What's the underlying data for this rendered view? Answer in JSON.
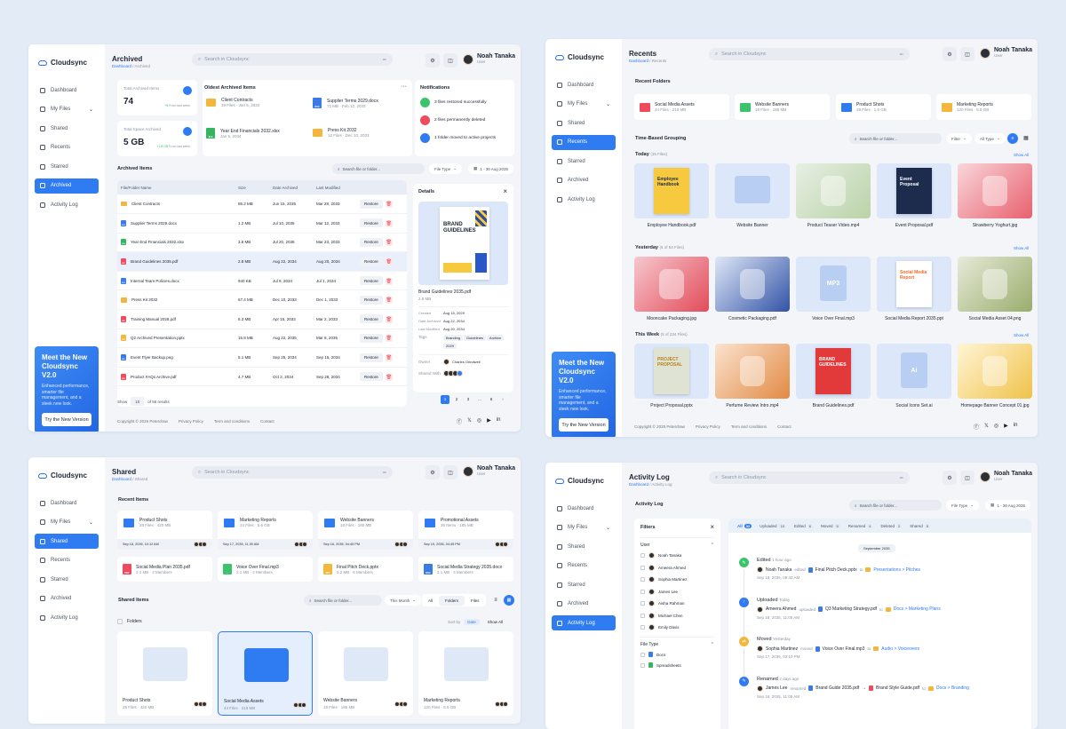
{
  "app": {
    "name": "Cloudsync",
    "user": "Noah Tanaka",
    "role": "User",
    "search_placeholder": "Search in Cloudsync"
  },
  "nav": [
    "Dashboard",
    "My Files",
    "Shared",
    "Recents",
    "Starred",
    "Archived",
    "Activity Log"
  ],
  "promo": {
    "title": "Meet the New Cloudsync V2.0",
    "text": "Enhanced performance, smarter file management, and a sleek new look.",
    "button": "Try the New Version"
  },
  "footer": {
    "copyright": "Copyright © 2025 Peterdraw",
    "links": [
      "Privacy Policy",
      "Term and conditions",
      "Contact"
    ]
  },
  "archived": {
    "title": "Archived",
    "crumb_home": "Dashboard",
    "crumb_current": "Archived",
    "stats": [
      {
        "label": "Total Archived Items",
        "value": "74",
        "trend": "+8",
        "trend_text": "From last week"
      },
      {
        "label": "Total Space Archived",
        "value": "5 GB",
        "trend": "+1.8 GB",
        "trend_text": "From last week"
      }
    ],
    "oldest_title": "Oldest Archived Items",
    "oldest": [
      {
        "name": "Client Contracts",
        "meta": "19 Files · Jan 5, 2034"
      },
      {
        "name": "Supplier Terms 2029.docx",
        "meta": "72 MB · Feb 12, 2033"
      },
      {
        "name": "Year End Financials 2032.xlsx",
        "meta": "Jan 5, 2034"
      },
      {
        "name": "Press Kit 2032",
        "meta": "12 Files · Dec 10, 2033"
      }
    ],
    "notifications_title": "Notifications",
    "notifications": [
      "3 files restored successfully",
      "2 files permanently deleted",
      "1 folder moved to active projects"
    ],
    "items_title": "Archived Items",
    "search_placeholder": "Search file or folder...",
    "file_type": "File Type",
    "date_range": "1 - 30 Aug 2035",
    "columns": [
      "File/Folder Name",
      "Size",
      "Date Archived",
      "Last Modified"
    ],
    "rows": [
      {
        "name": "Client Contracts",
        "size": "85.2 MB",
        "archived": "Jun 15, 2035",
        "modified": "Mar 28, 2033"
      },
      {
        "name": "Supplier Terms 2029.docx",
        "size": "1.2 MB",
        "archived": "Jul 10, 2035",
        "modified": "Mar 12, 2033"
      },
      {
        "name": "Year End Financials 2032.xlsx",
        "size": "3.8 MB",
        "archived": "Jul 20, 2035",
        "modified": "Mar 23, 2033"
      },
      {
        "name": "Brand Guidelines 2035.pdf",
        "size": "2.8 MB",
        "archived": "Aug 22, 2034",
        "modified": "Aug 20, 2034"
      },
      {
        "name": "Internal Team Policies.docx",
        "size": "940 KB",
        "archived": "Jul 9, 2034",
        "modified": "Jul 1, 2034"
      },
      {
        "name": "Press Kit 2032",
        "size": "67.4 MB",
        "archived": "Dec 10, 2033",
        "modified": "Dec 1, 2033"
      },
      {
        "name": "Training Manual 2028.pdf",
        "size": "6.3 MB",
        "archived": "Apr 15, 2033",
        "modified": "Mar 2, 2033"
      },
      {
        "name": "Q2 Archived Presentation.pptx",
        "size": "15.8 MB",
        "archived": "Aug 22, 2035",
        "modified": "Mar 8, 2035"
      },
      {
        "name": "Event Flyer Backup.png",
        "size": "5.1 MB",
        "archived": "Sep 25, 2034",
        "modified": "Sep 15, 2034"
      },
      {
        "name": "Product FAQs Archive.pdf",
        "size": "4.7 MB",
        "archived": "Oct 2, 2034",
        "modified": "Sep 28, 2034"
      }
    ],
    "restore": "Restore",
    "show": "Show",
    "show_n": "10",
    "of_results": "of 56 results",
    "pages": [
      "1",
      "2",
      "3",
      "...",
      "6"
    ],
    "details": {
      "title": "Details",
      "file": "Brand Guidelines 2035.pdf",
      "size": "2.8 MB",
      "cover_text": "Brand Guidelines",
      "fields": [
        [
          "Created",
          "Aug 15, 2029"
        ],
        [
          "Date Archived",
          "Aug 22, 2034"
        ],
        [
          "Last Modified",
          "Aug 20, 2034"
        ]
      ],
      "tags_label": "Tags",
      "tags": [
        "Branding",
        "Guidelines",
        "Archive",
        "2029"
      ],
      "owner_label": "Owner",
      "owner": "Charles Grindwell",
      "shared_label": "Shared With"
    }
  },
  "recents": {
    "title": "Recents",
    "crumb_current": "Recents",
    "folders_title": "Recent Folders",
    "folders": [
      {
        "name": "Social Media Assets",
        "meta": "44 Files · 210 MB"
      },
      {
        "name": "Website Banners",
        "meta": "18 Files · 185 MB"
      },
      {
        "name": "Product Shots",
        "meta": "28 Files · 1.5 GB"
      },
      {
        "name": "Marketing Reports",
        "meta": "120 Files · 5.6 GB"
      }
    ],
    "group_title": "Time-Based Grouping",
    "search_placeholder": "Search file or folder...",
    "filter": "Filter",
    "all_type": "All Type",
    "show_all": "Show All",
    "groups": [
      {
        "title": "Today",
        "count": "(15 Files)",
        "items": [
          "Employee Handbook.pdf",
          "Website Banner",
          "Product Teaser Video.mp4",
          "Event Proposal.pdf",
          "Strawberry Yoghurt.jpg"
        ]
      },
      {
        "title": "Yesterday",
        "count": "(5 of 54 Files)",
        "items": [
          "Mooncake Packaging.jpg",
          "Cosmetic Packaging.pdf",
          "Voice Over Final.mp3",
          "Social Media Report 2035.ppt",
          "Social Media Asset 04.png"
        ]
      },
      {
        "title": "This Week",
        "count": "(5 of 234 Files)",
        "items": [
          "Project Proposal.pptx",
          "Perfume Review Intro.mp4",
          "Brand Guidelines.pdf",
          "Social Icons Set.ai",
          "Homepage Banner Concept 01.jpg"
        ]
      }
    ],
    "thumb_text": {
      "handbook": "Employee Handbook",
      "proposal": "Event Proposal",
      "report": "Social Media Report",
      "project": "PROJECT PROPOSAL",
      "brand": "BRAND GUIDELINES",
      "mp3": "MP3",
      "ai": "Ai"
    }
  },
  "shared": {
    "title": "Shared",
    "crumb_current": "Shared",
    "recent_title": "Recent Items",
    "recent": [
      {
        "name": "Product Shots",
        "meta": "28 Files · 420 MB",
        "date": "Sep 18, 2035, 10:12 AM"
      },
      {
        "name": "Marketing Reports",
        "meta": "24 Files · 5.6 GB",
        "date": "Sep 17, 2035, 11:30 AM"
      },
      {
        "name": "Website Banners",
        "meta": "18 Files · 185 MB",
        "date": "Sep 16, 2035, 04:45 PM"
      },
      {
        "name": "Promotional Assets",
        "meta": "36 Items · 185 MB",
        "date": "Sep 15, 2035, 04:45 PM"
      }
    ],
    "recent_files": [
      {
        "name": "Social Media Plan 2035.pdf",
        "meta": "2.1 MB · 4 Members"
      },
      {
        "name": "Voice Over Final.mp3",
        "meta": "2.1 MB · 4 Members"
      },
      {
        "name": "Final Pitch Deck.pptx",
        "meta": "5.2 MB · 6 Members"
      },
      {
        "name": "Social Media Strategy 2035.docx",
        "meta": "2.1 MB · 4 Members"
      }
    ],
    "items_title": "Shared Items",
    "search_placeholder": "Search file or folder...",
    "period": "This Month",
    "filters": [
      "All",
      "Folders",
      "Files"
    ],
    "folders_label": "Folders",
    "sort_by": "Sort by",
    "sort_val": "Date",
    "show_all": "Show All",
    "folders": [
      {
        "name": "Product Shots",
        "meta": "28 Files · 420 MB"
      },
      {
        "name": "Social Media Assets",
        "meta": "44 Files · 210 MB"
      },
      {
        "name": "Website Banners",
        "meta": "18 Files · 185 MB"
      },
      {
        "name": "Marketing Reports",
        "meta": "120 Files · 5.6 GB"
      }
    ]
  },
  "activity": {
    "title": "Activity Log",
    "crumb_current": "Activity Log",
    "sub": "Activity Log",
    "search_placeholder": "Search file or folder...",
    "file_type": "File Type",
    "date_range": "1 - 30 Aug 2035",
    "filters_title": "Filters",
    "user_label": "User",
    "users": [
      "Noah Tanaka",
      "Ameera Ahmed",
      "Sophia Martinez",
      "James Lee",
      "Aisha Rahman",
      "Michael Chen",
      "Emily Davis"
    ],
    "filetype_label": "File Type",
    "filetypes": [
      "Docs",
      "Spreadsheets"
    ],
    "tabs": [
      [
        "All",
        "32"
      ],
      [
        "Uploaded",
        "10"
      ],
      [
        "Edited",
        "6"
      ],
      [
        "Moved",
        "5"
      ],
      [
        "Renamed",
        "4"
      ],
      [
        "Deleted",
        "2"
      ],
      [
        "Shared",
        "5"
      ]
    ],
    "date_chip": "September 2035",
    "events": [
      {
        "type": "Edited",
        "when": "1 hour ago",
        "user": "Noah Tanaka",
        "verb": "edited",
        "file": "Final Pitch Deck.pptx",
        "to": "to",
        "dest": "Presentations > Pitches",
        "time": "Sep 18, 2035, 09:42 AM",
        "color": "#3cc46c",
        "icon": "✎"
      },
      {
        "type": "Uploaded",
        "when": "Today",
        "user": "Ameera Ahmed",
        "verb": "uploaded",
        "file": "Q3 Marketing Strategy.pdf",
        "to": "to",
        "dest": "Docs > Marketing Plans",
        "time": "Sep 18, 2035, 11:05 AM",
        "color": "#2f7bf2",
        "icon": "↑"
      },
      {
        "type": "Moved",
        "when": "Yesterday",
        "user": "Sophia Martinez",
        "verb": "moved",
        "file": "Voice Over Final.mp3",
        "to": "to",
        "dest": "Audio > Voiceovers",
        "time": "Sep 17, 2035, 03:10 PM",
        "color": "#f4b73d",
        "icon": "⇄"
      },
      {
        "type": "Renamed",
        "when": "2 days ago",
        "user": "James Lee",
        "verb": "renamed",
        "file": "Brand Guide 2035.pdf",
        "arrow": "→",
        "file2": "Brand Style Guide.pdf",
        "to": "to",
        "dest": "Docs > Branding",
        "time": "Sep 16, 2035, 11:05 AM",
        "color": "#2f7bf2",
        "icon": "✎"
      }
    ]
  }
}
